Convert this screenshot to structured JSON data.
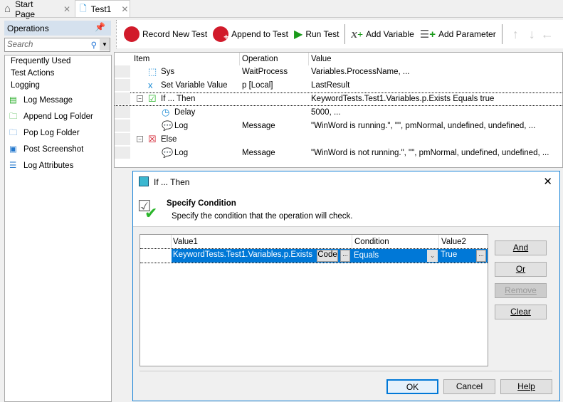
{
  "tabs": [
    {
      "label": "Start Page",
      "icon": "home-icon"
    },
    {
      "label": "Test1",
      "icon": "keyword-test-icon"
    }
  ],
  "operations": {
    "title": "Operations",
    "search_placeholder": "Search",
    "categories": [
      "Frequently Used",
      "Test Actions",
      "Logging"
    ],
    "items": [
      "Log Message",
      "Append Log Folder",
      "Pop Log Folder",
      "Post Screenshot",
      "Log Attributes"
    ]
  },
  "toolbar": {
    "record": "Record New Test",
    "append": "Append to Test",
    "run": "Run Test",
    "add_variable": "Add Variable",
    "add_parameter": "Add Parameter"
  },
  "grid": {
    "columns": [
      "Item",
      "Operation",
      "Value"
    ],
    "rows": [
      {
        "item": "Sys",
        "operation": "WaitProcess",
        "value": "Variables.ProcessName, ..."
      },
      {
        "item": "Set Variable Value",
        "operation": "p [Local]",
        "value": "LastResult"
      },
      {
        "item": "If ... Then",
        "operation": "",
        "value": "KeywordTests.Test1.Variables.p.Exists Equals true"
      },
      {
        "item": "Delay",
        "operation": "",
        "value": "5000, ..."
      },
      {
        "item": "Log",
        "operation": "Message",
        "value": "\"WinWord is running.\", \"\", pmNormal, undefined, undefined, ..."
      },
      {
        "item": "Else",
        "operation": "",
        "value": ""
      },
      {
        "item": "Log",
        "operation": "Message",
        "value": "\"WinWord is not running.\", \"\", pmNormal, undefined, undefined, ..."
      }
    ]
  },
  "dialog": {
    "title": "If ... Then",
    "heading": "Specify Condition",
    "subheading": "Specify the condition that the operation will check.",
    "columns": [
      "Value1",
      "Condition",
      "Value2"
    ],
    "row": {
      "value1": "KeywordTests.Test1.Variables.p.Exists",
      "code": "Code",
      "ellipsis": "...",
      "condition": "Equals",
      "value2": "True"
    },
    "side_buttons": [
      "And",
      "Or",
      "Remove",
      "Clear"
    ],
    "ok": "OK",
    "cancel": "Cancel",
    "help": "Help"
  },
  "colors": {
    "selection": "#0078d7",
    "accent": "#1883d7"
  }
}
